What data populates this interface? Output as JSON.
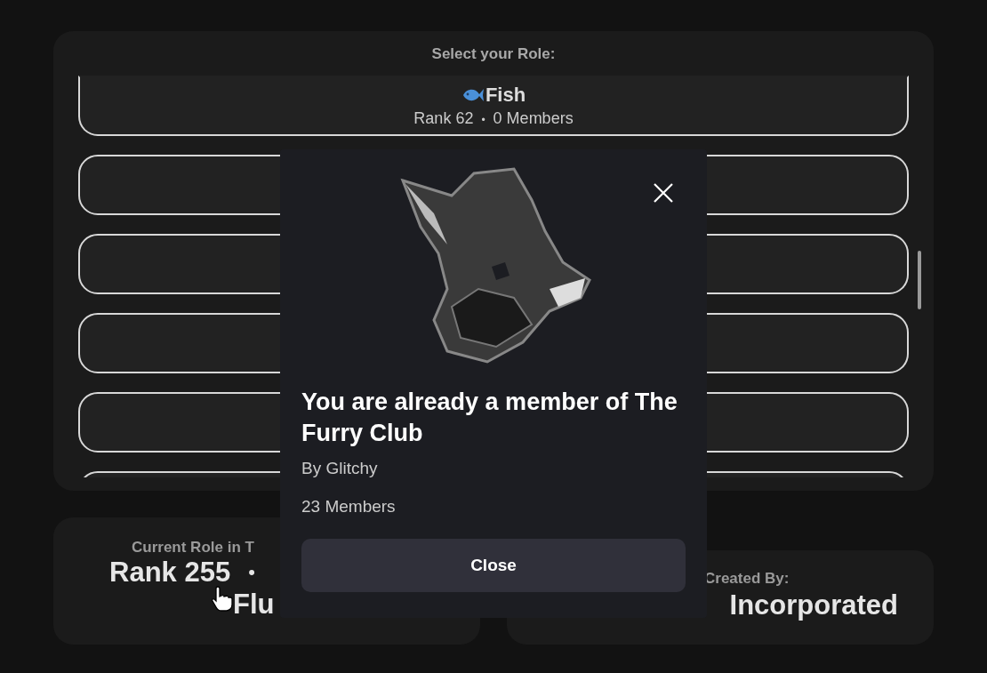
{
  "role_picker": {
    "title": "Select your Role:",
    "roles": [
      {
        "kind": "named",
        "name": "Fish",
        "rank": "Rank 62",
        "separator": "•",
        "members": "0 Members"
      },
      {
        "kind": "covered"
      },
      {
        "kind": "covered"
      },
      {
        "kind": "covered"
      },
      {
        "kind": "covered"
      },
      {
        "kind": "covered"
      }
    ]
  },
  "current_role": {
    "label": "Current Role in T",
    "rank": "Rank 255",
    "separator": "•",
    "role_name": "Flu"
  },
  "creator": {
    "label": "Created By:",
    "name": "Incorporated"
  },
  "dialog": {
    "title": "You are already a member of The Furry Club",
    "by": "By Glitchy",
    "members": "23 Members",
    "button": "Close"
  }
}
